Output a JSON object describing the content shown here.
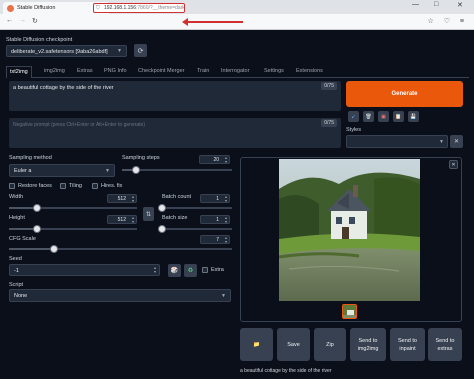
{
  "browser": {
    "tab_title": "Stable Diffusion",
    "tab_close": "×",
    "new_tab": "+",
    "window_controls": {
      "minimize": "—",
      "maximize": "□",
      "close": "✕"
    },
    "nav": {
      "back": "←",
      "forward": "→",
      "reload": "↻"
    },
    "url_host": "192.168.1.156",
    "url_rest": ":7860/?__theme=dark",
    "highlight_color": "#d32f2f"
  },
  "checkpoint": {
    "label": "Stable Diffusion checkpoint",
    "value": "deliberate_v2.safetensors [9aba26abdf]",
    "refresh_icon": "refresh-icon"
  },
  "tabs": [
    "txt2img",
    "img2img",
    "Extras",
    "PNG Info",
    "Checkpoint Merger",
    "Train",
    "Interrogator",
    "Settings",
    "Extensions"
  ],
  "prompt": {
    "value": "a beautiful cottage by the side of the river",
    "counter": "0/75"
  },
  "negative_prompt": {
    "placeholder": "Negative prompt (press Ctrl+Enter or Alt+Enter to generate)",
    "counter": "0/75"
  },
  "generate_label": "Generate",
  "styles_label": "Styles",
  "sampling": {
    "method_label": "Sampling method",
    "method_value": "Euler a",
    "steps_label": "Sampling steps",
    "steps_value": "20",
    "steps_fraction": 0.13
  },
  "options": {
    "restore_faces": "Restore faces",
    "tiling": "Tiling",
    "hires_fix": "Hires. fix"
  },
  "width": {
    "label": "Width",
    "value": "512",
    "fraction": 0.22
  },
  "height": {
    "label": "Height",
    "value": "512",
    "fraction": 0.22
  },
  "batch_count": {
    "label": "Batch count",
    "value": "1",
    "fraction": 0.0
  },
  "batch_size": {
    "label": "Batch size",
    "value": "1",
    "fraction": 0.0
  },
  "cfg": {
    "label": "CFG Scale",
    "value": "7",
    "fraction": 0.2
  },
  "seed": {
    "label": "Seed",
    "value": "-1",
    "extra_label": "Extra"
  },
  "script": {
    "label": "Script",
    "value": "None"
  },
  "output": {
    "buttons": [
      "📁",
      "Save",
      "Zip",
      "Send to img2img",
      "Send to inpaint",
      "Send to extras"
    ],
    "caption": "a beautiful cottage by the side of the river"
  },
  "colors": {
    "background": "#0b0f19",
    "panel": "#1f2937",
    "accent": "#ea580c"
  }
}
